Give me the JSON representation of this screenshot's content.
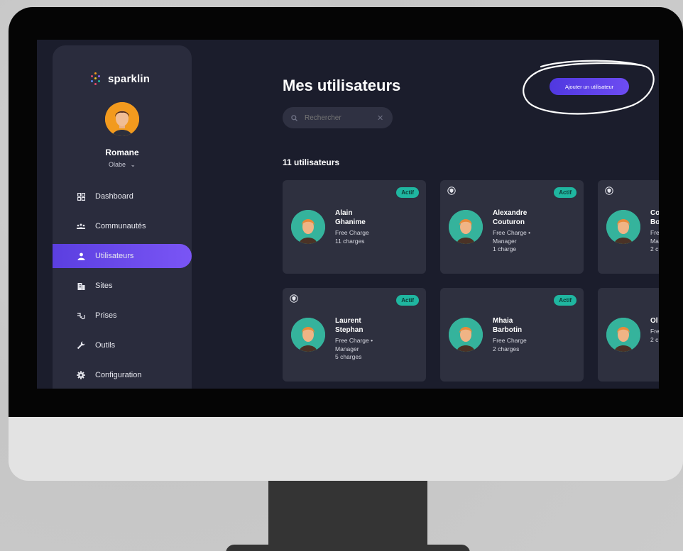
{
  "app": {
    "logo_text": "sparklin",
    "user": {
      "name": "Romane",
      "org": "Olabe",
      "org_chevron": "chevron-down-icon"
    }
  },
  "sidebar": {
    "items": [
      {
        "label": "Dashboard",
        "icon": "grid-icon",
        "active": false
      },
      {
        "label": "Communautés",
        "icon": "community-icon",
        "active": false
      },
      {
        "label": "Utilisateurs",
        "icon": "user-icon",
        "active": true
      },
      {
        "label": "Sites",
        "icon": "building-icon",
        "active": false
      },
      {
        "label": "Prises",
        "icon": "plug-icon",
        "active": false
      },
      {
        "label": "Outils",
        "icon": "wrench-icon",
        "active": false
      },
      {
        "label": "Configuration",
        "icon": "gear-icon",
        "active": false
      }
    ]
  },
  "main": {
    "title": "Mes utilisateurs",
    "add_button": "Ajouter un utilisateur",
    "search": {
      "placeholder": "Rechercher",
      "value": ""
    },
    "count": "11 utilisateurs"
  },
  "cards": [
    {
      "name_line1": "Alain",
      "name_line2": "Ghanime",
      "meta": [
        "Free Charge",
        "11 charges"
      ],
      "badge": "Actif",
      "shield": false
    },
    {
      "name_line1": "Alexandre",
      "name_line2": "Couturon",
      "meta": [
        "Free Charge •",
        "Manager",
        "1 charge"
      ],
      "badge": "Actif",
      "shield": true
    },
    {
      "name_line1": "Co",
      "name_line2": "Bo",
      "meta": [
        "Fre",
        "Ma",
        "2 c"
      ],
      "badge": "",
      "shield": true
    },
    {
      "name_line1": "Laurent",
      "name_line2": "Stephan",
      "meta": [
        "Free Charge •",
        "Manager",
        "5 charges"
      ],
      "badge": "Actif",
      "shield": true
    },
    {
      "name_line1": "Mhaia",
      "name_line2": "Barbotin",
      "meta": [
        "Free Charge",
        "2 charges"
      ],
      "badge": "Actif",
      "shield": false
    },
    {
      "name_line1": "Ol",
      "name_line2": "",
      "meta": [
        "Fre",
        "2 c"
      ],
      "badge": "",
      "shield": false
    }
  ],
  "colors": {
    "accent": "#6a4cf0",
    "badge": "#1fb6a0",
    "screen_bg": "#1b1d2c",
    "card_bg": "#2e303f",
    "sidebar_bg": "#2a2c3d"
  }
}
